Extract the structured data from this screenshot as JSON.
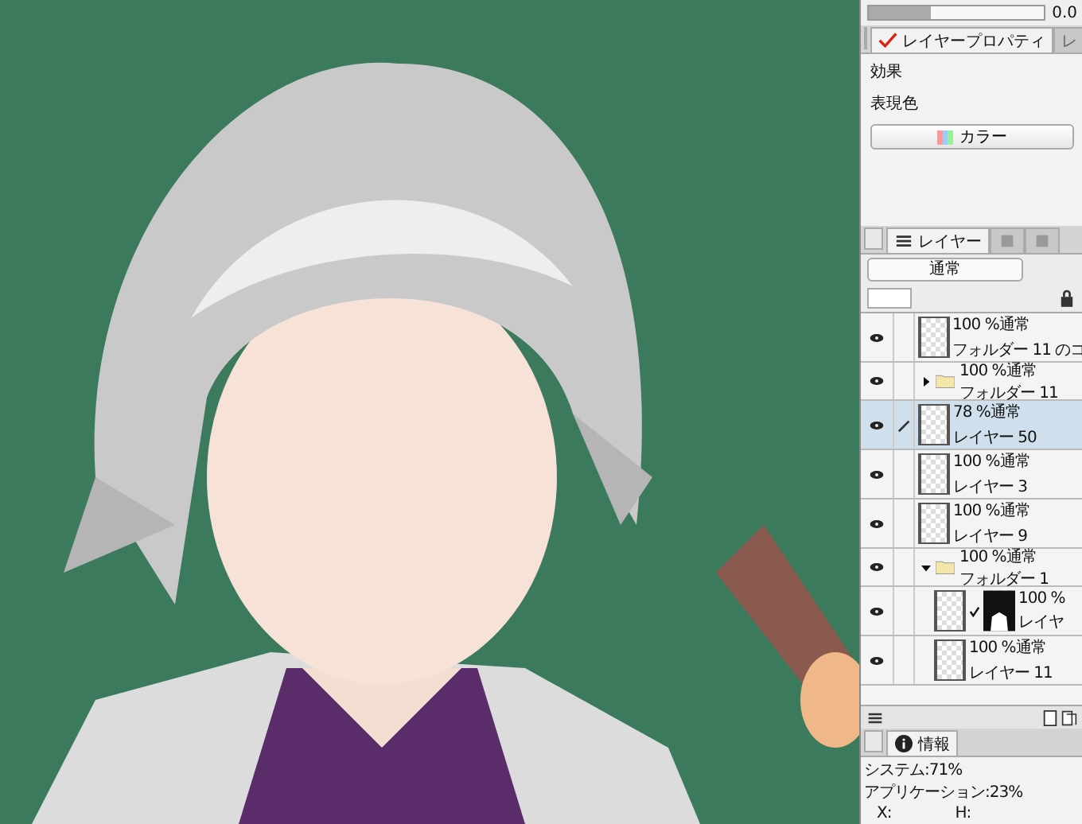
{
  "top_slider": {
    "level": 0.35,
    "reading": "0.0"
  },
  "property_tabs": [
    {
      "label": "レイヤープロパティ",
      "selected": true
    },
    {
      "label": "レ",
      "selected": false
    }
  ],
  "properties": {
    "effect_label": "効果",
    "color_label": "表現色",
    "color_button": "カラー"
  },
  "layer_tabs": [
    {
      "label": "レイヤー",
      "selected": true
    },
    {
      "selected": false
    },
    {
      "selected": false
    }
  ],
  "blend_mode": "通常",
  "layers": [
    {
      "kind": "layer",
      "mode": "100 %通常",
      "name": "フォルダー 11 のコ",
      "visible": true,
      "selected": false
    },
    {
      "kind": "folder",
      "mode": "100 %通常",
      "name": "フォルダー 11",
      "visible": true,
      "selected": false,
      "expanded": false
    },
    {
      "kind": "layer",
      "mode": "78 %通常",
      "name": "レイヤー 50",
      "visible": true,
      "selected": true,
      "editing": true
    },
    {
      "kind": "layer",
      "mode": "100 %通常",
      "name": "レイヤー 3",
      "visible": true,
      "selected": false
    },
    {
      "kind": "layer",
      "mode": "100 %通常",
      "name": "レイヤー 9",
      "visible": true,
      "selected": false
    },
    {
      "kind": "folder",
      "mode": "100 %通常",
      "name": "フォルダー 1",
      "visible": true,
      "selected": false,
      "expanded": true,
      "children": [
        {
          "kind": "masked",
          "mode": "100 %",
          "name": "レイヤ",
          "visible": true,
          "selected": false
        },
        {
          "kind": "layer",
          "mode": "100 %通常",
          "name": "レイヤー 11",
          "visible": true,
          "selected": false
        }
      ]
    }
  ],
  "info": {
    "tab": "情報",
    "system": "システム:71%",
    "application": "アプリケーション:23%",
    "x_label": "X:",
    "h_label": "H:"
  }
}
